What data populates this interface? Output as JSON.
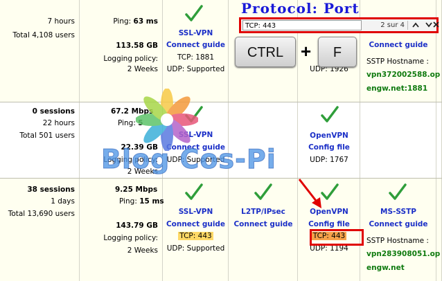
{
  "overlay": {
    "title": "Protocol: Port",
    "findbar": {
      "query": "TCP: 443",
      "match_count": "2 sur 4"
    },
    "keys": {
      "ctrl": "CTRL",
      "plus": "+",
      "f": "F"
    },
    "watermark": "Blog Cos-Pi"
  },
  "rows": [
    {
      "sessions": "",
      "uptime": "7 hours",
      "total_users": "Total 4,108 users",
      "speed": "",
      "ping_label": "Ping: ",
      "ping_value": "63 ms",
      "transfer": "113.58 GB",
      "logging_label": "Logging policy:",
      "logging_value": "2 Weeks",
      "sslvpn": {
        "title": "SSL-VPN",
        "link": "Connect guide",
        "tcp": "TCP: 1881",
        "udp": "UDP: Supported"
      },
      "openvpn": {
        "udp": "UDP: 1926"
      },
      "sstp": {
        "link": "Connect guide",
        "hostname_label": "SSTP Hostname :",
        "hostname_line1": "vpn372002588.op",
        "hostname_line2": "engw.net:1881"
      }
    },
    {
      "sessions": "0 sessions",
      "uptime": "22 hours",
      "total_users": "Total 501 users",
      "speed": "67.2",
      "speed_unit": "Mbps",
      "ping_label": "Ping: ",
      "ping_value": "5",
      "transfer": "22.39 GB",
      "logging_label": "Logging policy:",
      "logging_value": "2 Weeks",
      "sslvpn": {
        "title": "SSL-VPN",
        "link": "Connect guide",
        "udp": "UDP: Supported"
      },
      "openvpn": {
        "title": "OpenVPN",
        "link": "Config file",
        "udp": "UDP: 1767"
      }
    },
    {
      "sessions": "38 sessions",
      "uptime": "1 days",
      "total_users": "Total 13,690 users",
      "speed": "9.25 Mbps",
      "ping_label": "Ping: ",
      "ping_value": "15 ms",
      "transfer": "143.79 GB",
      "logging_label": "Logging policy:",
      "logging_value": "2 Weeks",
      "sslvpn": {
        "title": "SSL-VPN",
        "link": "Connect guide",
        "tcp": "TCP: 443",
        "udp": "UDP: Supported"
      },
      "l2tp": {
        "title": "L2TP/IPsec",
        "link": "Connect guide"
      },
      "openvpn": {
        "title": "OpenVPN",
        "link": "Config file",
        "tcp": "TCP: 443",
        "udp": "UDP: 1194"
      },
      "sstp": {
        "title": "MS-SSTP",
        "link": "Connect guide",
        "hostname_label": "SSTP Hostname :",
        "hostname_line1": "vpn283908051.op",
        "hostname_line2": "engw.net"
      }
    }
  ],
  "colors": {
    "check": "#2f9e3a",
    "link": "#1b2fc7",
    "highlight": "#ffd966",
    "highlight_current": "#f7a24a",
    "annotation_red": "#e00000"
  }
}
